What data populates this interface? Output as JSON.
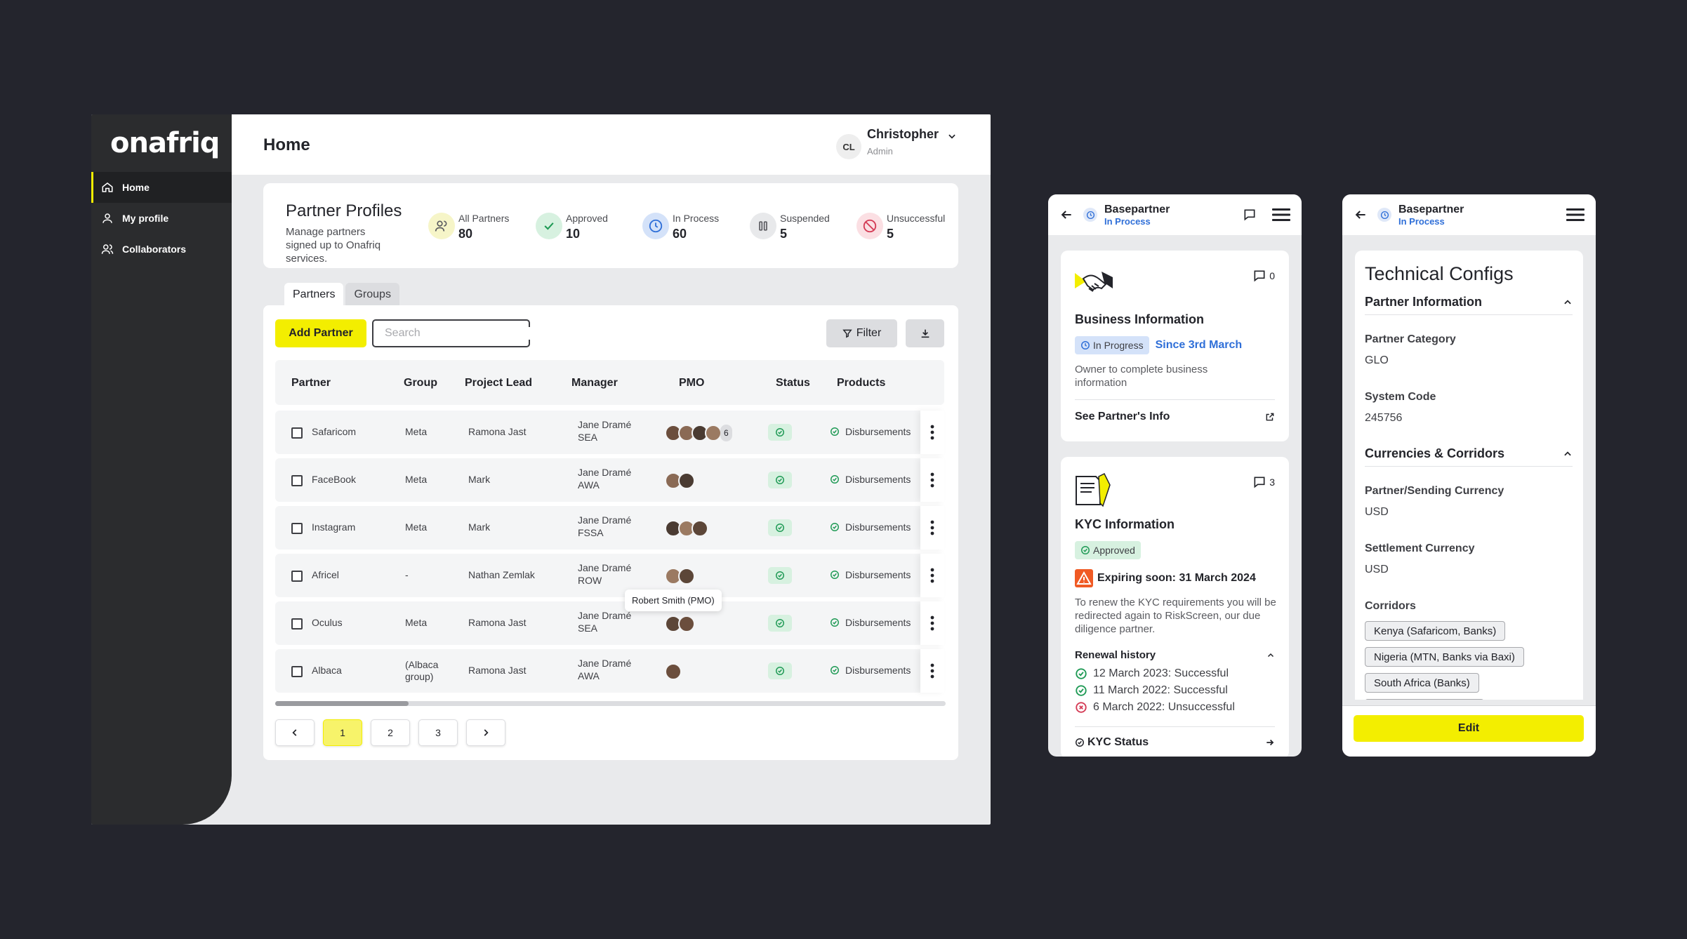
{
  "brand": {
    "logo": "onafriq",
    "accent": "#f3ee00"
  },
  "sidebar": {
    "items": [
      {
        "label": "Home",
        "icon": "home-icon"
      },
      {
        "label": "My profile",
        "icon": "user-icon"
      },
      {
        "label": "Collaborators",
        "icon": "users-icon"
      }
    ]
  },
  "header": {
    "title": "Home",
    "user": {
      "initials": "CL",
      "name": "Christopher",
      "role": "Admin"
    }
  },
  "profiles": {
    "title": "Partner Profiles",
    "subtitle": "Manage partners signed up to Onafriq services.",
    "stats": [
      {
        "label": "All Partners",
        "value": "80"
      },
      {
        "label": "Approved",
        "value": "10"
      },
      {
        "label": "In Process",
        "value": "60"
      },
      {
        "label": "Suspended",
        "value": "5"
      },
      {
        "label": "Unsuccessful",
        "value": "5"
      }
    ]
  },
  "tabs": [
    "Partners",
    "Groups"
  ],
  "toolbar": {
    "add_label": "Add Partner",
    "search_placeholder": "Search",
    "filter_label": "Filter"
  },
  "table": {
    "columns": [
      "Partner",
      "Group",
      "Project Lead",
      "Manager",
      "PMO",
      "Status",
      "Products"
    ],
    "rows": [
      {
        "partner": "Safaricom",
        "group": "Meta",
        "lead": "Ramona Jast",
        "manager": "Jane Dramé",
        "region": "SEA",
        "pmo_extra": "6",
        "product": "Disbursements"
      },
      {
        "partner": "FaceBook",
        "group": "Meta",
        "lead": "Mark",
        "manager": "Jane Dramé",
        "region": "AWA",
        "pmo_extra": "",
        "product": "Disbursements"
      },
      {
        "partner": "Instagram",
        "group": "Meta",
        "lead": "Mark",
        "manager": "Jane Dramé",
        "region": "FSSA",
        "pmo_extra": "",
        "product": "Disbursements"
      },
      {
        "partner": "Africel",
        "group": "-",
        "lead": "Nathan Zemlak",
        "manager": "Jane Dramé",
        "region": "ROW",
        "pmo_extra": "",
        "product": "Disbursements"
      },
      {
        "partner": "Oculus",
        "group": "Meta",
        "lead": "Ramona Jast",
        "manager": "Jane Dramé",
        "region": "SEA",
        "pmo_extra": "",
        "product": "Disbursements"
      },
      {
        "partner": "Albaca",
        "group": "(Albaca group)",
        "lead": "Ramona Jast",
        "manager": "Jane Dramé",
        "region": "AWA",
        "pmo_extra": "",
        "product": "Disbursements"
      }
    ],
    "tooltip": "Robert Smith (PMO)"
  },
  "pagination": {
    "pages": [
      "1",
      "2",
      "3"
    ],
    "current": "1"
  },
  "mobile1": {
    "partner": "Basepartner",
    "status": "In Process",
    "business": {
      "title": "Business Information",
      "comments": "0",
      "badge": "In Progress",
      "since": "Since 3rd March",
      "note": "Owner to complete business information",
      "link": "See Partner's Info"
    },
    "kyc": {
      "title": "KYC Information",
      "comments": "3",
      "badge": "Approved",
      "warning": "Expiring soon: 31 March 2024",
      "note": "To renew the KYC requirements you will be redirected again to RiskScreen, our due diligence partner.",
      "history_title": "Renewal history",
      "history": [
        {
          "text": "12 March 2023: Successful",
          "ok": true
        },
        {
          "text": "11 March 2022: Successful",
          "ok": true
        },
        {
          "text": "6 March 2022: Unsuccessful",
          "ok": false
        }
      ],
      "status_link": "KYC Status"
    }
  },
  "mobile2": {
    "partner": "Basepartner",
    "status": "In Process",
    "title": "Technical Configs",
    "section1": "Partner Information",
    "category_label": "Partner Category",
    "category": "GLO",
    "code_label": "System Code",
    "code": "245756",
    "section2": "Currencies & Corridors",
    "sending_label": "Partner/Sending Currency",
    "sending": "USD",
    "settlement_label": "Settlement Currency",
    "settlement": "USD",
    "corridors_label": "Corridors",
    "corridors": [
      "Kenya (Safaricom, Banks)",
      "Nigeria (MTN, Banks via Baxi)",
      "South Africa (Banks)"
    ],
    "edit_label": "Edit"
  }
}
